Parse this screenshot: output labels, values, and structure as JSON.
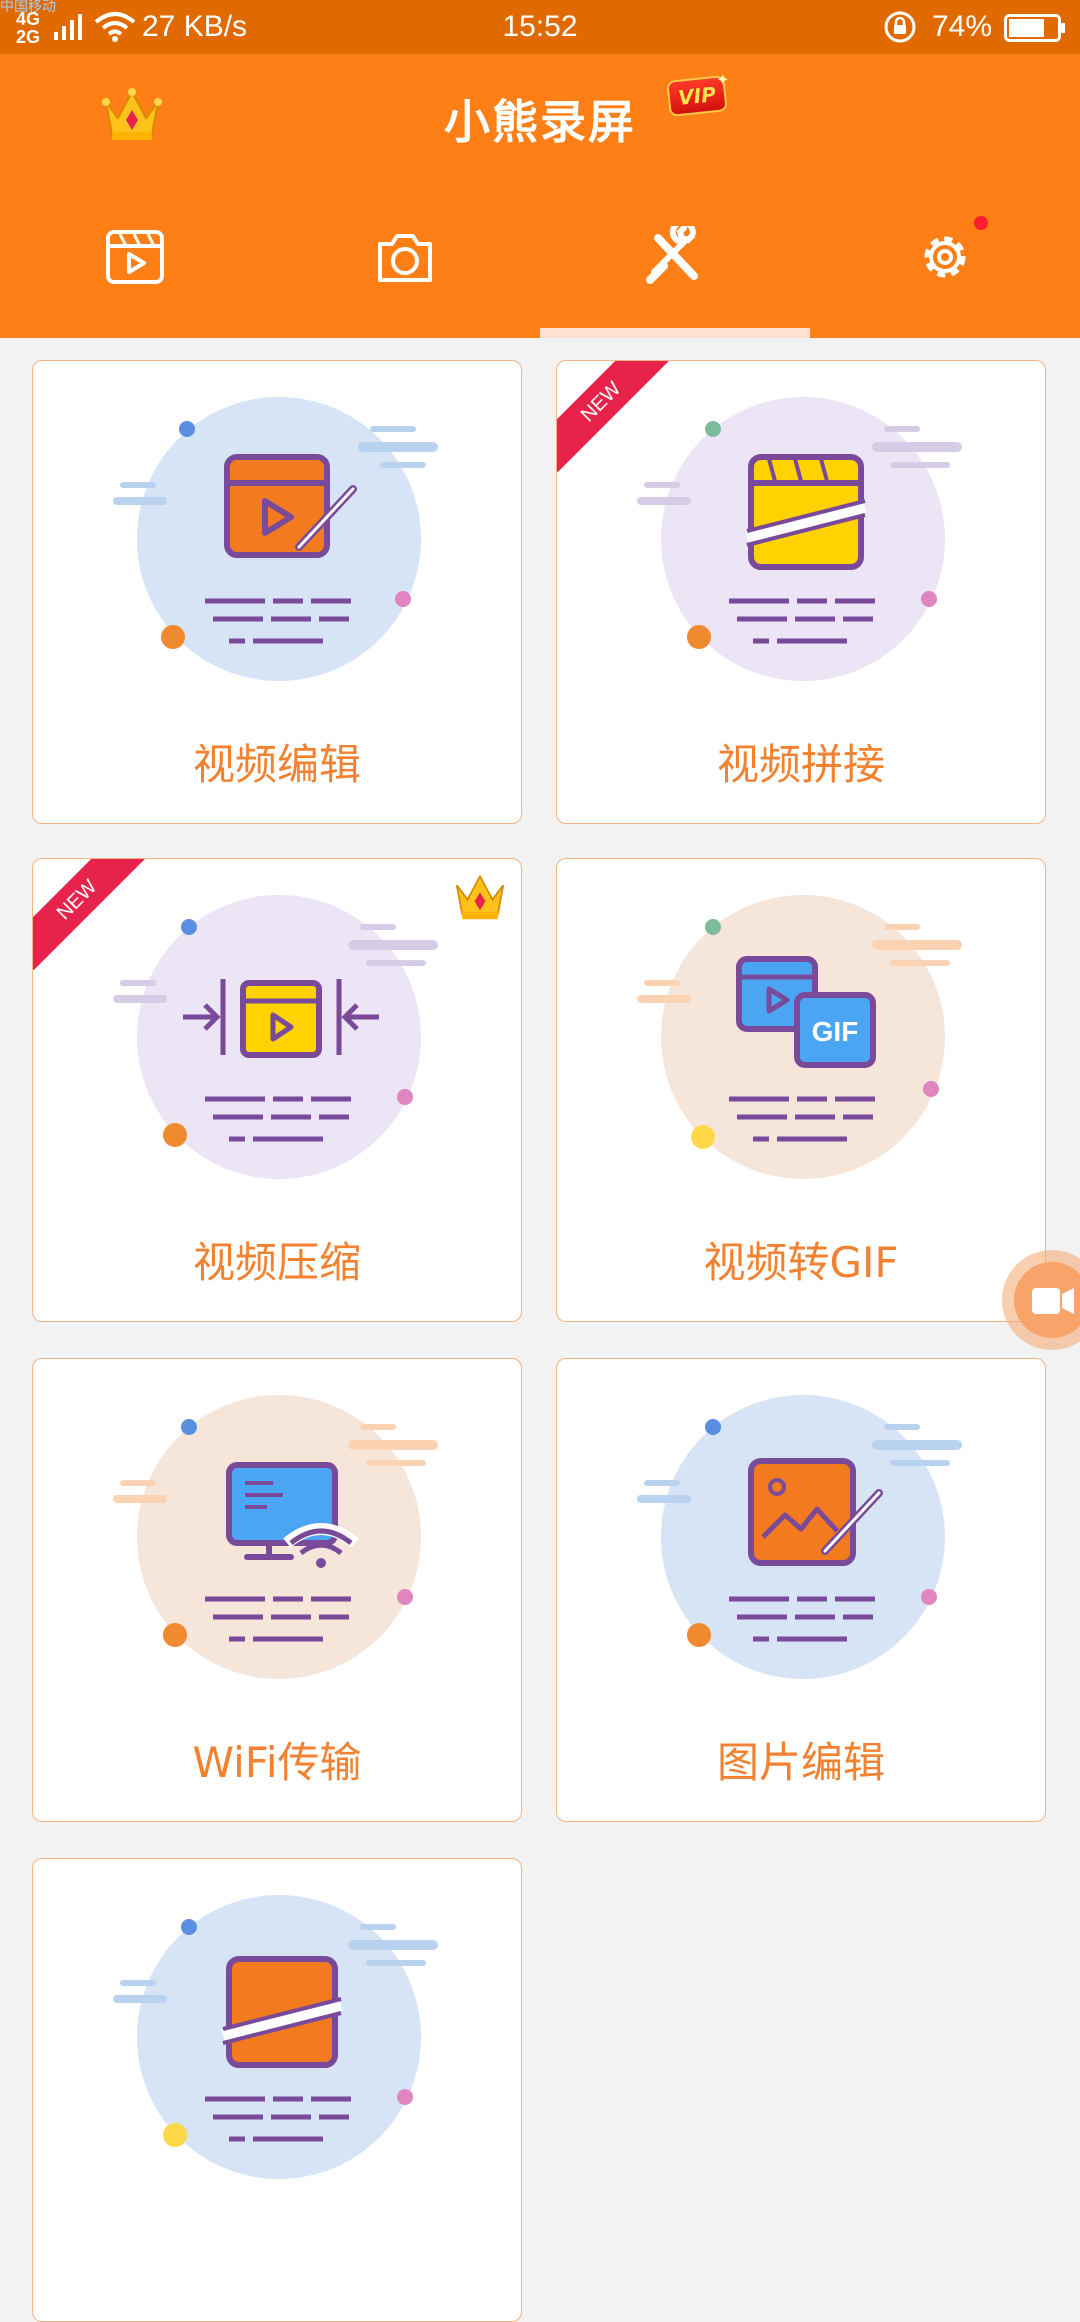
{
  "status_bar": {
    "carrier_text": "中国移动",
    "network_4g": "4G",
    "network_2g": "2G",
    "speed": "27 KB/s",
    "time": "15:52",
    "battery_percent": "74%",
    "battery_level": 0.74
  },
  "header": {
    "title": "小熊录屏",
    "vip_badge": "VIP",
    "tabs": [
      {
        "icon": "video-list-icon"
      },
      {
        "icon": "camera-icon"
      },
      {
        "icon": "tools-icon",
        "selected": true
      },
      {
        "icon": "settings-icon",
        "has_notification": true
      }
    ]
  },
  "tools": [
    {
      "label": "视频编辑",
      "badge_new": false,
      "premium": false,
      "blob_color": "#d6e4f6"
    },
    {
      "label": "视频拼接",
      "badge_new": true,
      "badge_text": "NEW",
      "premium": false,
      "blob_color": "#ebe5f5"
    },
    {
      "label": "视频压缩",
      "badge_new": true,
      "badge_text": "NEW",
      "premium": true,
      "blob_color": "#ebe5f5"
    },
    {
      "label": "视频转GIF",
      "badge_new": false,
      "premium": false,
      "blob_color": "#f6e6da",
      "icon_text": "GIF"
    },
    {
      "label": "WiFi传输",
      "badge_new": false,
      "premium": false,
      "blob_color": "#f6e6da"
    },
    {
      "label": "图片编辑",
      "badge_new": false,
      "premium": false,
      "blob_color": "#d6e4f6"
    },
    {
      "label": "",
      "badge_new": false,
      "premium": false,
      "blob_color": "#d6e4f6"
    }
  ],
  "colors": {
    "header_orange": "#fd7f16",
    "status_orange": "#e06a00",
    "label_orange": "#f28130",
    "new_ribbon": "#e7234b",
    "icon_purple": "#7a4a9a"
  }
}
